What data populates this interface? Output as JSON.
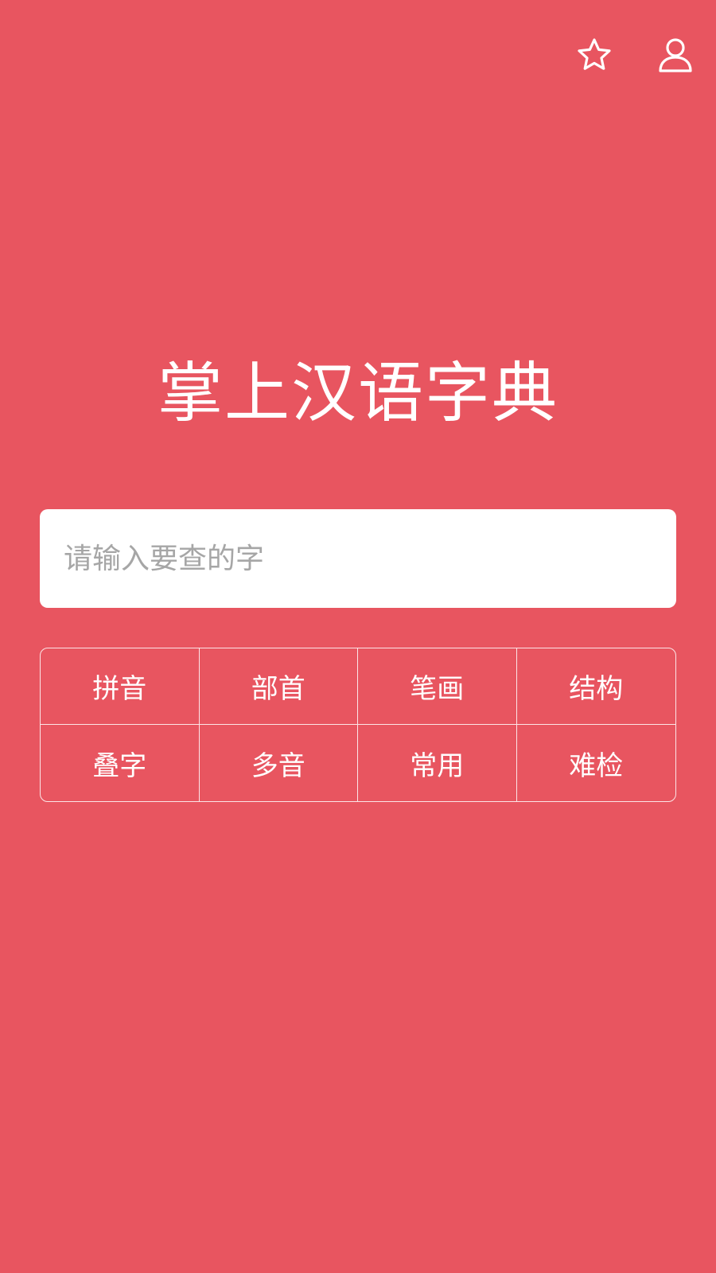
{
  "header": {
    "icons": [
      "star-icon",
      "user-icon"
    ]
  },
  "app": {
    "title": "掌上汉语字典"
  },
  "search": {
    "placeholder": "请输入要查的字",
    "value": ""
  },
  "categories": [
    {
      "label": "拼音"
    },
    {
      "label": "部首"
    },
    {
      "label": "笔画"
    },
    {
      "label": "结构"
    },
    {
      "label": "叠字"
    },
    {
      "label": "多音"
    },
    {
      "label": "常用"
    },
    {
      "label": "难检"
    }
  ],
  "colors": {
    "background": "#E85560",
    "text": "#FFFFFF",
    "placeholder": "#A6A6A6"
  }
}
